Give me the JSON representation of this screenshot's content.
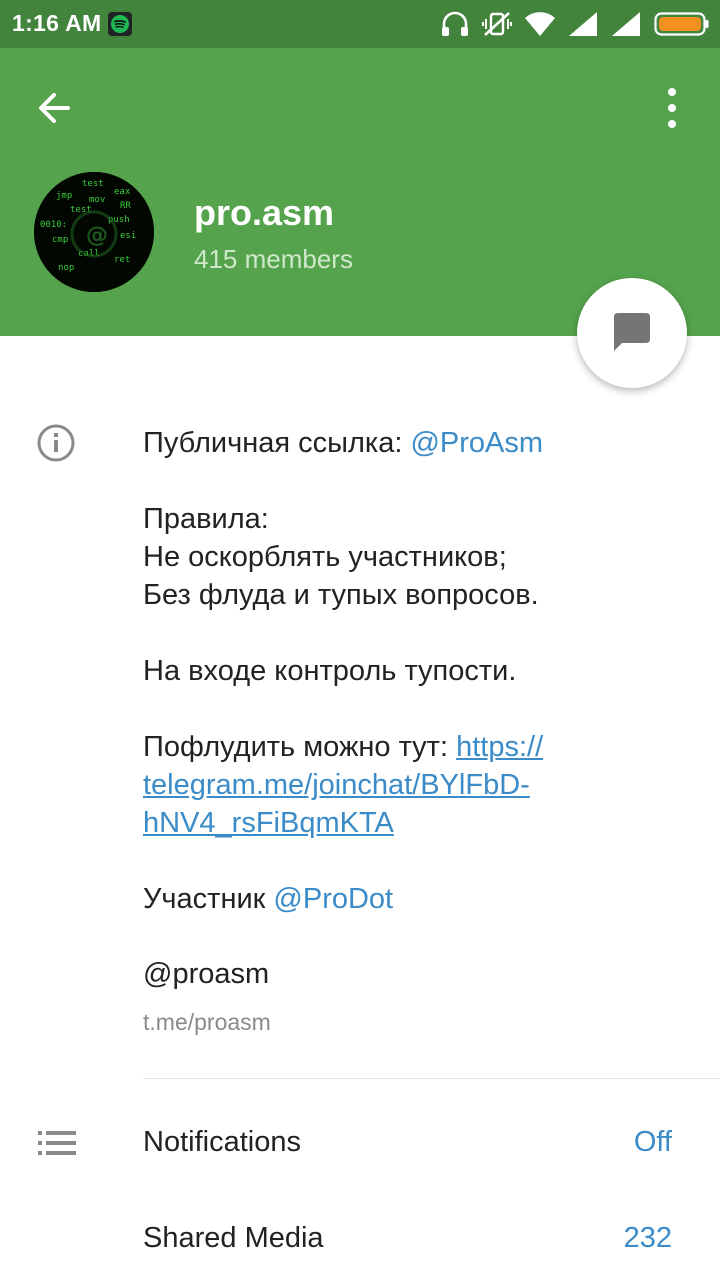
{
  "status_bar": {
    "time": "1:16 AM",
    "icons": [
      "spotify-icon",
      "headphones-icon",
      "vibrate-off-icon",
      "wifi-icon",
      "signal-icon",
      "signal-icon",
      "battery-icon"
    ],
    "battery_color": "#f0901e"
  },
  "header": {
    "title": "pro.asm",
    "members": "415 members",
    "accent_color": "#55a34c",
    "status_color": "#43843d"
  },
  "info": {
    "line1_prefix": "Публичная ссылка: ",
    "line1_link": "@ProAsm",
    "rules_title": "Правила:",
    "rule1": "Не оскорблять участников;",
    "rule2": "Без флуда и тупых вопросов.",
    "control": "На входе контроль тупости.",
    "flood_prefix": "Пофлудить можно тут: ",
    "flood_url_1": "https://",
    "flood_url_2": "telegram.me/joinchat/BYlFbD-",
    "flood_url_3": "hNV4_rsFiBqmKTA",
    "member_prefix": "Участник ",
    "member_link": "@ProDot",
    "username": "@proasm",
    "short_link": "t.me/proasm"
  },
  "rows": {
    "notifications_label": "Notifications",
    "notifications_value": "Off",
    "shared_media_label": "Shared Media",
    "shared_media_value": "232"
  },
  "link_color": "#3a8bc8"
}
